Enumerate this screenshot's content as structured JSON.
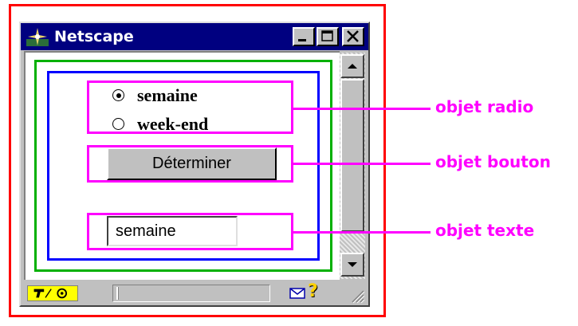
{
  "window": {
    "title": "Netscape",
    "controls": {
      "minimize_icon": "minimize-icon",
      "maximize_icon": "maximize-icon",
      "close_icon": "close-icon"
    }
  },
  "form": {
    "radios": [
      {
        "label": "semaine",
        "checked": true
      },
      {
        "label": "week-end",
        "checked": false
      }
    ],
    "button_label": "Déterminer",
    "text_value": "semaine"
  },
  "annotations": {
    "radio": "objet radio",
    "button": "objet bouton",
    "text": "objet texte"
  },
  "colors": {
    "outer_frame": "#ff0000",
    "green_frame": "#00b000",
    "blue_frame": "#0000ff",
    "annotation": "#ff00ff",
    "titlebar": "#000080"
  },
  "statusbar": {
    "icons": [
      "security-key-icon",
      "connection-icon",
      "mail-icon",
      "help-icon"
    ]
  }
}
